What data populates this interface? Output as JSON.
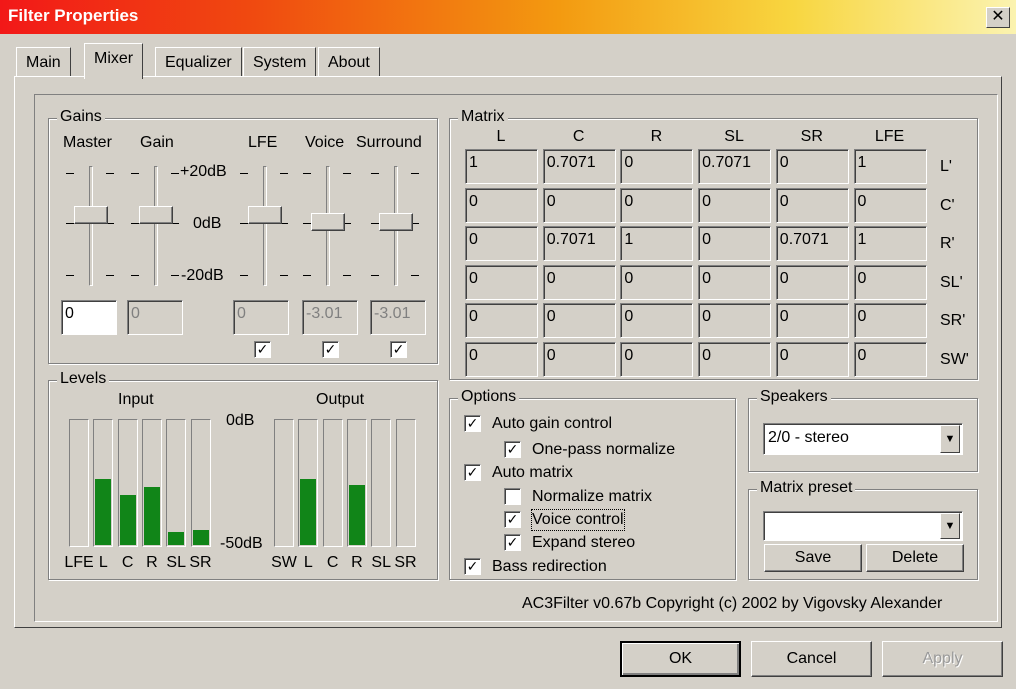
{
  "window": {
    "title": "Filter Properties",
    "close_glyph": "✕"
  },
  "tabs": [
    {
      "label": "Main"
    },
    {
      "label": "Mixer",
      "active": true
    },
    {
      "label": "Equalizer"
    },
    {
      "label": "System"
    },
    {
      "label": "About"
    }
  ],
  "gains": {
    "title": "Gains",
    "columns": [
      "Master",
      "Gain",
      "LFE",
      "Voice",
      "Surround"
    ],
    "scale": [
      "+20dB",
      "0dB",
      "-20dB"
    ],
    "sliders": [
      {
        "name": "Master",
        "db": 0
      },
      {
        "name": "Gain",
        "db": 0
      },
      {
        "name": "LFE",
        "db": 0
      },
      {
        "name": "Voice",
        "db": -3.01
      },
      {
        "name": "Surround",
        "db": -3.01
      }
    ],
    "values": [
      "0",
      "0",
      "0",
      "-3.01",
      "-3.01"
    ],
    "checkboxes": [
      true,
      true,
      true
    ]
  },
  "levels": {
    "title": "Levels",
    "input_label": "Input",
    "output_label": "Output",
    "top_label": "0dB",
    "bottom_label": "-50dB",
    "input_channels": [
      "LFE",
      "L",
      "C",
      "R",
      "SL",
      "SR"
    ],
    "output_channels": [
      "SW",
      "L",
      "C",
      "R",
      "SL",
      "SR"
    ],
    "input_levels": [
      0,
      0.52,
      0.4,
      0.46,
      0.1,
      0.12
    ],
    "output_levels": [
      0,
      0.52,
      0,
      0.48,
      0,
      0
    ]
  },
  "matrix": {
    "title": "Matrix",
    "col_headers": [
      "L",
      "C",
      "R",
      "SL",
      "SR",
      "LFE"
    ],
    "row_headers": [
      "L'",
      "C'",
      "R'",
      "SL'",
      "SR'",
      "SW'"
    ],
    "rows": [
      [
        "1",
        "0.7071",
        "0",
        "0.7071",
        "0",
        "1"
      ],
      [
        "0",
        "0",
        "0",
        "0",
        "0",
        "0"
      ],
      [
        "0",
        "0.7071",
        "1",
        "0",
        "0.7071",
        "1"
      ],
      [
        "0",
        "0",
        "0",
        "0",
        "0",
        "0"
      ],
      [
        "0",
        "0",
        "0",
        "0",
        "0",
        "0"
      ],
      [
        "0",
        "0",
        "0",
        "0",
        "0",
        "0"
      ]
    ]
  },
  "options": {
    "title": "Options",
    "auto_gain": {
      "label": "Auto gain control",
      "checked": true
    },
    "one_pass": {
      "label": "One-pass normalize",
      "checked": true
    },
    "auto_matrix": {
      "label": "Auto matrix",
      "checked": true
    },
    "normalize_matrix": {
      "label": "Normalize matrix",
      "checked": false
    },
    "voice_control": {
      "label": "Voice control",
      "checked": true
    },
    "expand_stereo": {
      "label": "Expand stereo",
      "checked": true
    },
    "bass_redirection": {
      "label": "Bass redirection",
      "checked": true
    }
  },
  "speakers": {
    "title": "Speakers",
    "value": "2/0 - stereo"
  },
  "matrix_preset": {
    "title": "Matrix preset",
    "value": "",
    "save": "Save",
    "delete": "Delete"
  },
  "copyright": "AC3Filter v0.67b Copyright (c) 2002 by Vigovsky Alexander",
  "buttons": {
    "ok": "OK",
    "cancel": "Cancel",
    "apply": "Apply"
  }
}
